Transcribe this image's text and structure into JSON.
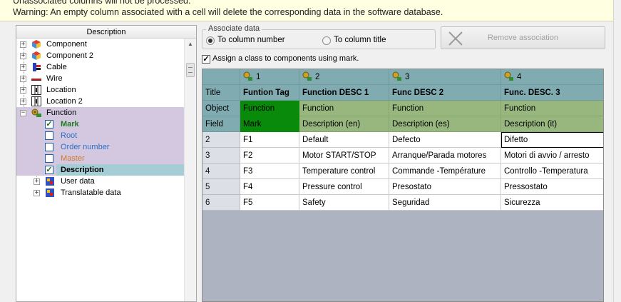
{
  "banner": {
    "line1": "Unassociated columns will not be processed.",
    "line2": "Warning: An empty column associated with a cell will delete the corresponding data in the software database."
  },
  "tree": {
    "header": "Description",
    "items": [
      {
        "label": "Component",
        "icon": "component-icon",
        "expander": "+"
      },
      {
        "label": "Component 2",
        "icon": "component-icon",
        "expander": "+"
      },
      {
        "label": "Cable",
        "icon": "cable-icon",
        "expander": "+"
      },
      {
        "label": "Wire",
        "icon": "wire-icon",
        "expander": "+"
      },
      {
        "label": "Location",
        "icon": "location-icon",
        "expander": "+"
      },
      {
        "label": "Location 2",
        "icon": "location-icon",
        "expander": "+"
      },
      {
        "label": "Function",
        "icon": "function-icon",
        "expander": "−"
      }
    ],
    "function_children": [
      {
        "label": "Mark",
        "checked": true,
        "color": "#1f7a1f"
      },
      {
        "label": "Root",
        "checked": false,
        "color": "#2d6fc4"
      },
      {
        "label": "Order number",
        "checked": false,
        "color": "#2d6fc4"
      },
      {
        "label": "Master",
        "checked": false,
        "color": "#d07a2a"
      },
      {
        "label": "Description",
        "checked": true,
        "color": "#000000"
      }
    ],
    "sub_groups": [
      {
        "label": "User data",
        "icon": "user-data-icon",
        "expander": "+"
      },
      {
        "label": "Translatable data",
        "icon": "translatable-data-icon",
        "expander": "+"
      }
    ]
  },
  "associate": {
    "legend": "Associate data",
    "option_number": "To column number",
    "option_title": "To column title",
    "selected": "number"
  },
  "remove_button": "Remove association",
  "assign_checkbox": {
    "label": "Assign a class to components using mark.",
    "checked": true
  },
  "grid": {
    "column_numbers": [
      "1",
      "2",
      "3",
      "4"
    ],
    "row_labels": {
      "title": "Title",
      "object": "Object",
      "field": "Field"
    },
    "titles": [
      "Funtion Tag",
      "Function DESC 1",
      "Func DESC 2",
      "Func. DESC. 3"
    ],
    "objects": [
      "Function",
      "Function",
      "Function",
      "Function"
    ],
    "fields": [
      "Mark",
      "Description (en)",
      "Description (es)",
      "Description (it)"
    ],
    "rows": [
      {
        "num": "2",
        "cells": [
          "F1",
          "Default",
          "Defecto",
          "Difetto"
        ]
      },
      {
        "num": "3",
        "cells": [
          "F2",
          "Motor START/STOP",
          "Arranque/Parada motores",
          "Motori di avvio / arresto"
        ]
      },
      {
        "num": "4",
        "cells": [
          "F3",
          "Temperature control",
          "Commande -Température",
          "Controllo -Temperatura"
        ]
      },
      {
        "num": "5",
        "cells": [
          "F4",
          "Pressure control",
          "Presostato",
          "Pressostato"
        ]
      },
      {
        "num": "6",
        "cells": [
          "F5",
          "Safety",
          "Seguridad",
          "Sicurezza"
        ]
      }
    ]
  }
}
